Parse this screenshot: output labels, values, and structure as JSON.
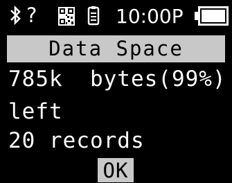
{
  "status_bar": {
    "icons": [
      "bluetooth-icon",
      "unknown-icon",
      "qr-code-icon",
      "scanner-icon",
      "battery-icon"
    ],
    "unknown_glyph": "?",
    "time": "10:00P"
  },
  "dialog": {
    "title": "Data Space",
    "line1": "785k  bytes(99%)",
    "line2": "left",
    "line3": "20 records",
    "ok_label": "OK"
  },
  "colors": {
    "background": "#000000",
    "foreground": "#ffffff",
    "highlight": "#c8c8c8"
  }
}
